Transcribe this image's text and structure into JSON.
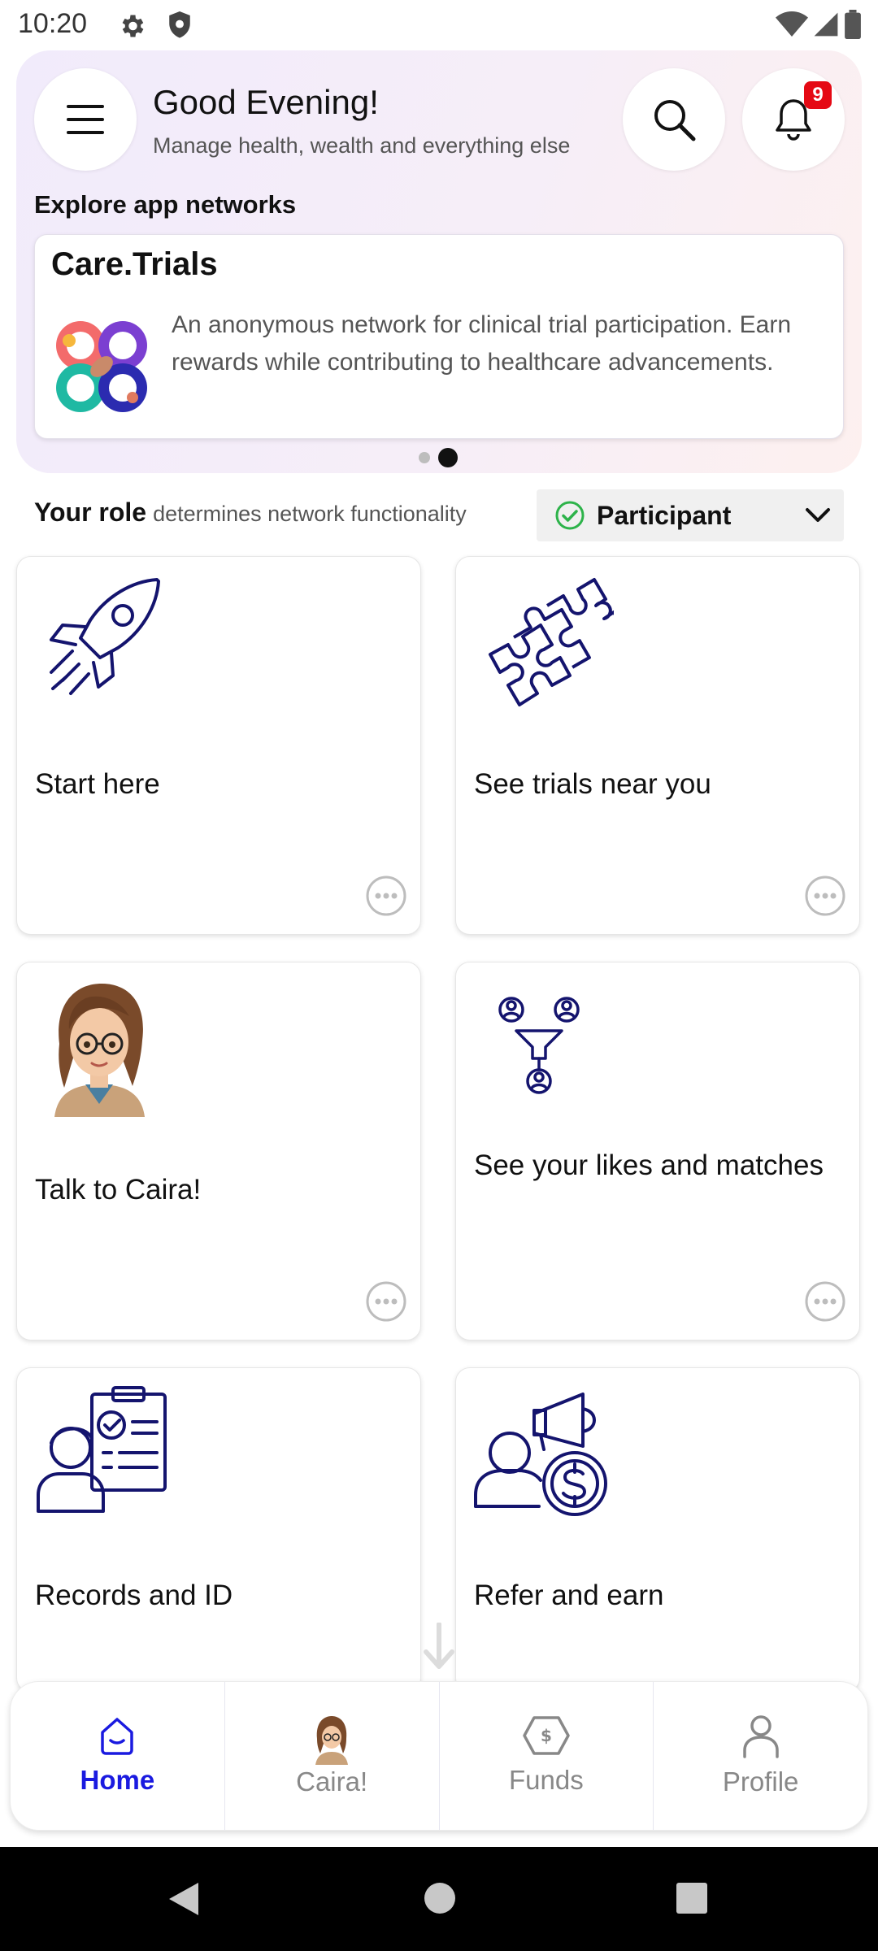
{
  "status_bar": {
    "time": "10:20"
  },
  "header": {
    "greeting": "Good Evening!",
    "subtitle": "Manage health, wealth and everything else",
    "notification_count": "9",
    "explore_label": "Explore app networks"
  },
  "network_card": {
    "title": "Care.Trials",
    "description": "An anonymous network for clinical trial participation. Earn rewards while contributing to healthcare advancements."
  },
  "role": {
    "title": "Your role",
    "description": "determines network functionality",
    "selected": "Participant"
  },
  "tiles": [
    {
      "label": "Start here",
      "icon": "rocket-icon"
    },
    {
      "label": "See trials near you",
      "icon": "puzzle-icon"
    },
    {
      "label": "Talk to Caira!",
      "icon": "caira-avatar"
    },
    {
      "label": "See your likes and matches",
      "icon": "matches-icon"
    },
    {
      "label": "Records and ID",
      "icon": "records-icon"
    },
    {
      "label": "Refer and earn",
      "icon": "refer-icon"
    }
  ],
  "bottom_nav": [
    {
      "label": "Home",
      "icon": "home-icon",
      "active": true
    },
    {
      "label": "Caira!",
      "icon": "caira-avatar",
      "active": false
    },
    {
      "label": "Funds",
      "icon": "funds-icon",
      "active": false
    },
    {
      "label": "Profile",
      "icon": "profile-icon",
      "active": false
    }
  ],
  "colors": {
    "accent": "#1a1ae0",
    "icon_navy": "#14146e",
    "badge": "#e50914",
    "check": "#2db34a"
  }
}
